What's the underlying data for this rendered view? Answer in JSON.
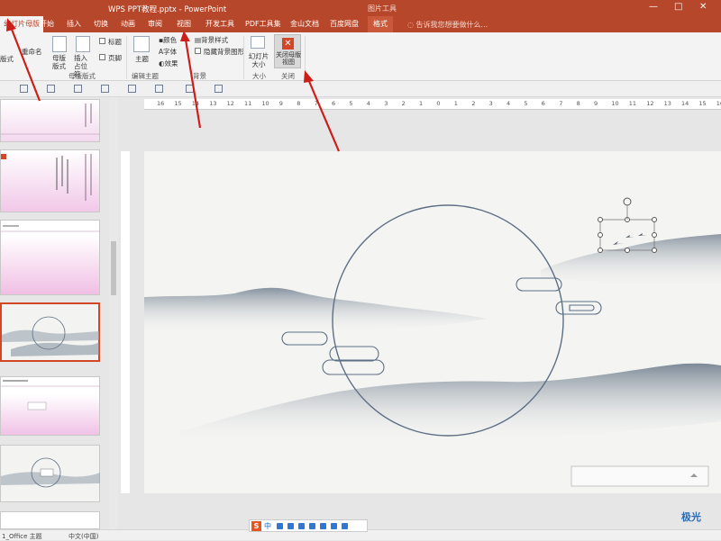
{
  "titlebar": {
    "title": "WPS PPT教程.pptx - PowerPoint",
    "tool_tab": "图片工具",
    "min": "—",
    "max": "□",
    "close": "✕"
  },
  "tabs": {
    "active": "幻灯片母版",
    "items": [
      "开始",
      "插入",
      "切换",
      "动画",
      "审阅",
      "视图",
      "开发工具",
      "PDF工具集",
      "金山文档",
      "百度网盘"
    ],
    "format": "格式",
    "search": "告诉我您想要做什么..."
  },
  "ribbon": {
    "edit_theme_group": {
      "left_labels": [
        "版式",
        "重命名"
      ],
      "master_layout": "母版版式",
      "insert_placeholder": "插入占位符",
      "title_check": "标题",
      "footer_check": "页脚",
      "group_label": "母版版式"
    },
    "theme": "主题",
    "colors": "颜色",
    "fonts": "字体",
    "effects": "效果",
    "edit_theme_label": "编辑主题",
    "bg_styles": "背景样式",
    "hide_bg": "隐藏背景图形",
    "bg_label": "背景",
    "slide_size": "幻灯片大小",
    "size_label": "大小",
    "close_master": "关闭母版视图",
    "close_label": "关闭"
  },
  "ruler": {
    "labels": [
      "16",
      "15",
      "14",
      "13",
      "12",
      "11",
      "10",
      "9",
      "8",
      "7",
      "6",
      "5",
      "4",
      "3",
      "2",
      "1",
      "0",
      "1",
      "2",
      "3",
      "4",
      "5",
      "6",
      "7",
      "8",
      "9",
      "10",
      "11",
      "12",
      "13",
      "14",
      "15",
      "16"
    ]
  },
  "status": {
    "theme": "1_Office 主题",
    "lang": "中文(中国)",
    "ime_letter": "S",
    "ime_mode": "中"
  },
  "watermark": "极光",
  "colors": {
    "accent": "#b7472a",
    "selected_thumb": "#d24726",
    "arrow": "#cc1f1a",
    "circle": "#5d6f85"
  }
}
